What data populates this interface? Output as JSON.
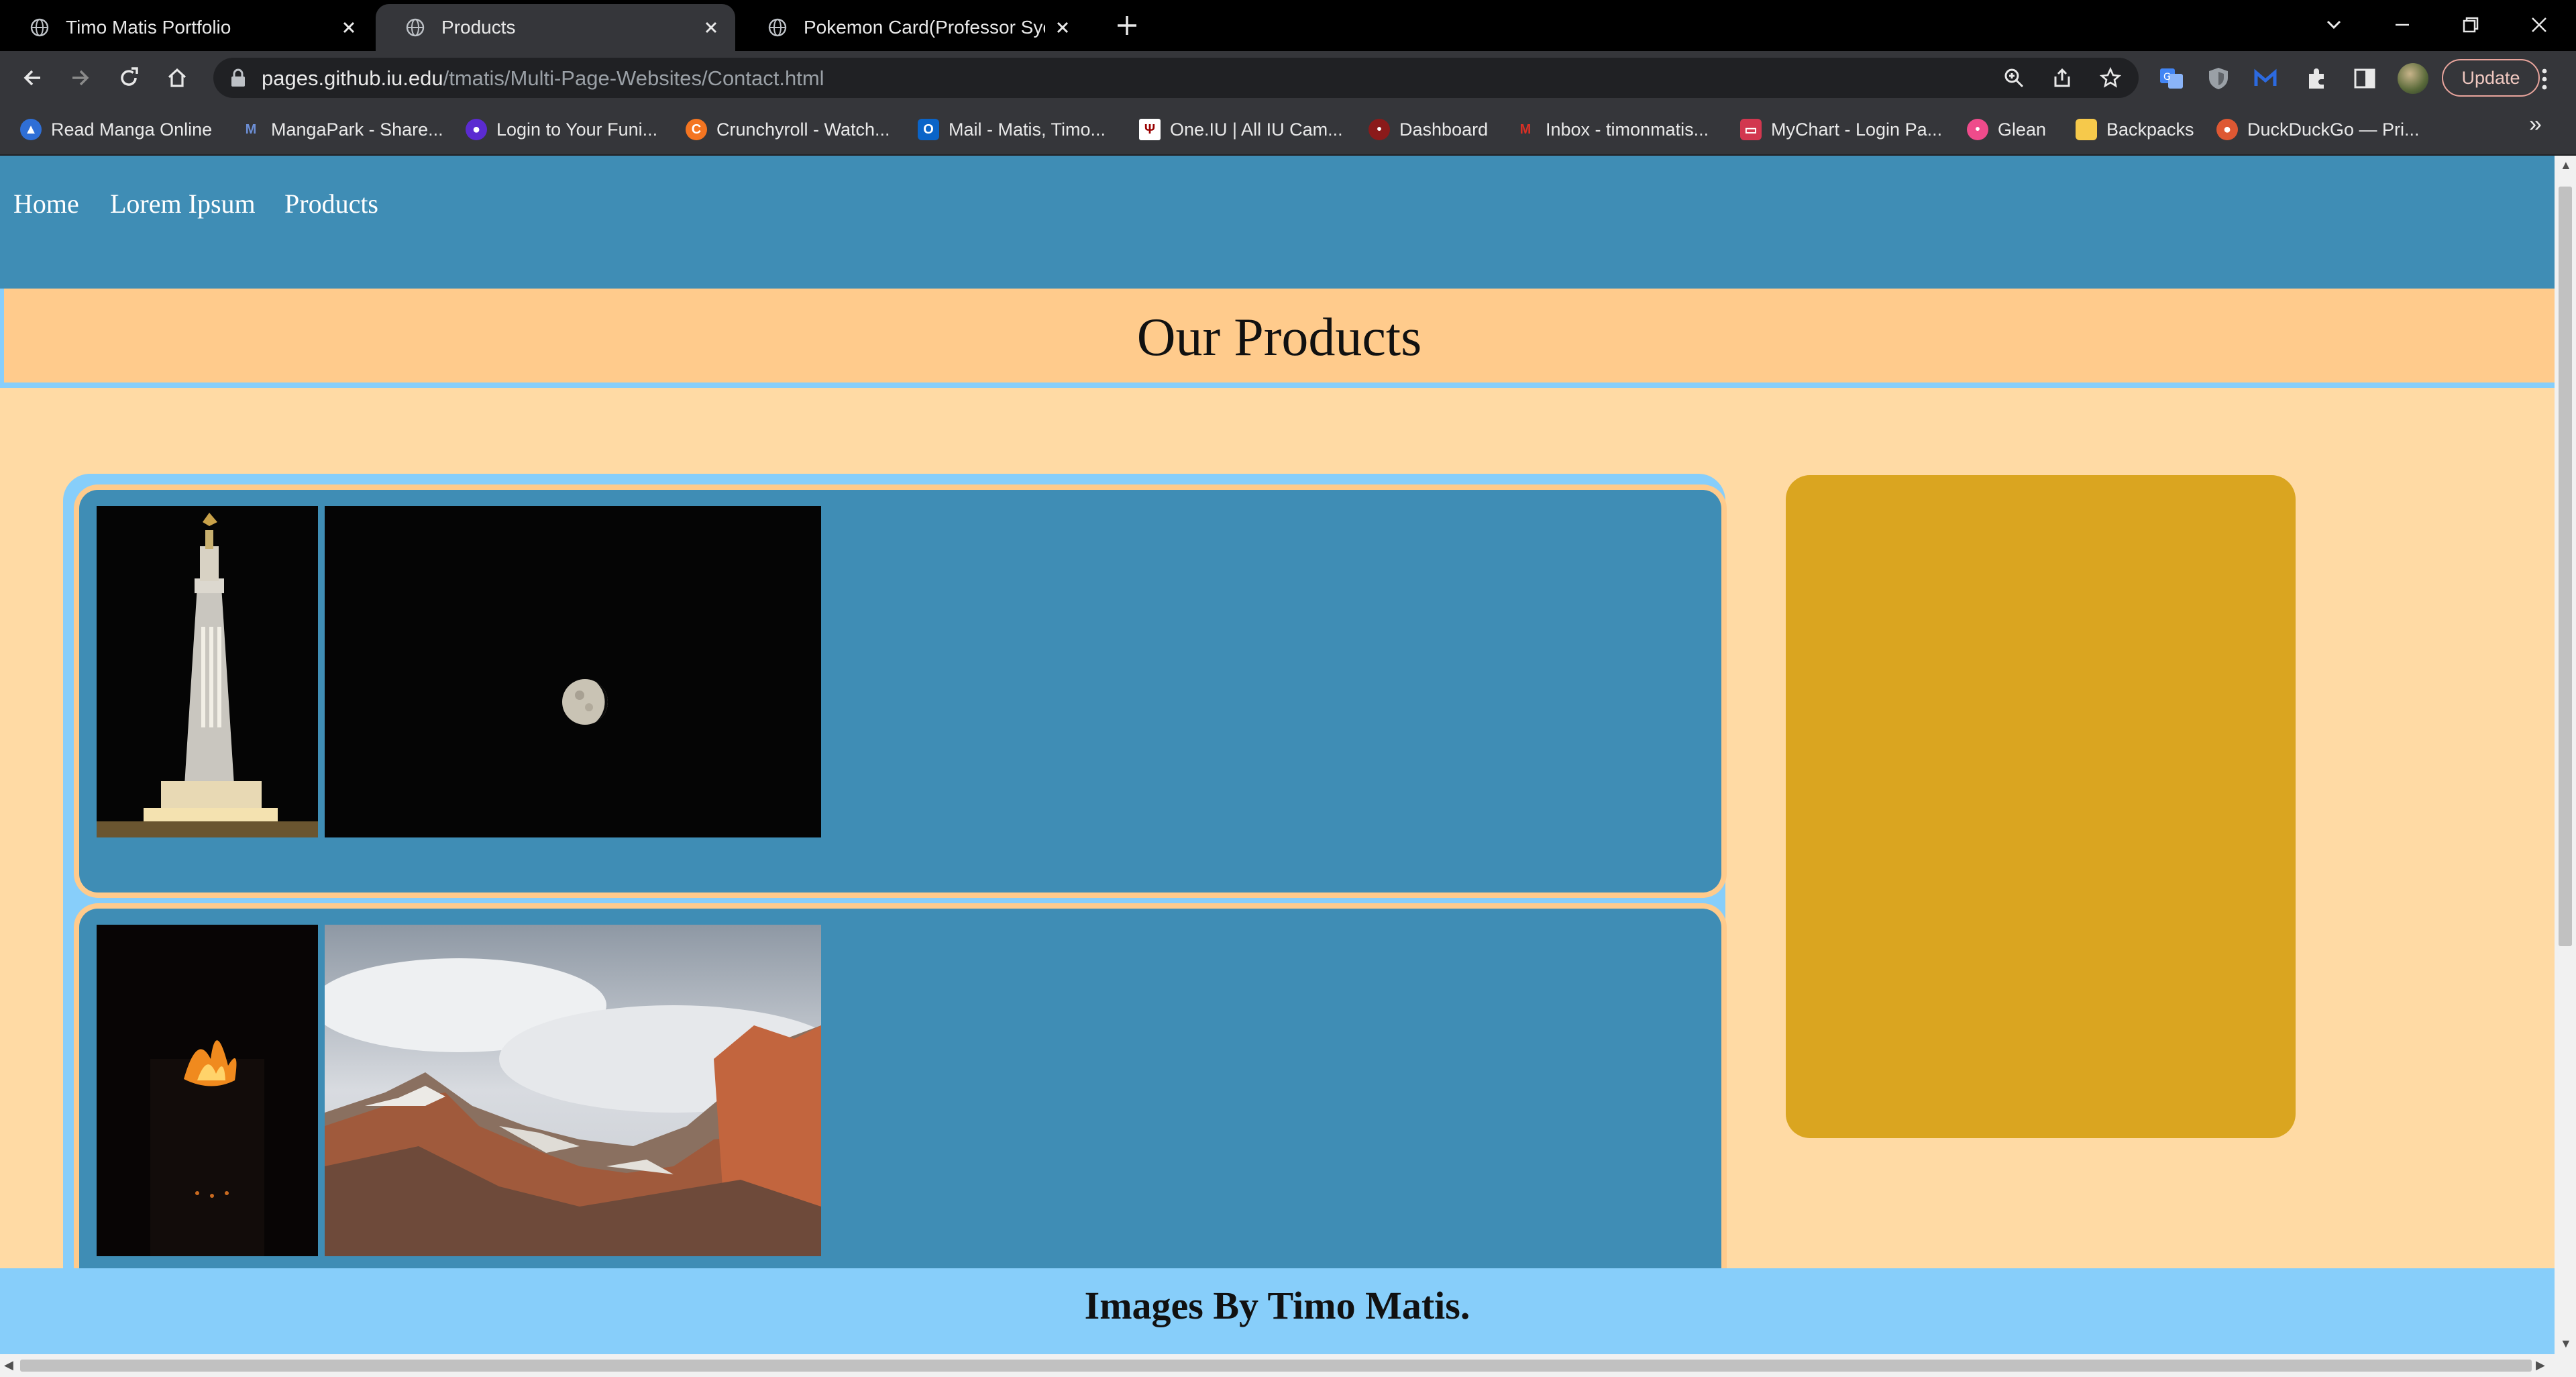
{
  "browser": {
    "tabs": [
      {
        "title": "Timo Matis Portfolio",
        "active": false
      },
      {
        "title": "Products",
        "active": true
      },
      {
        "title": "Pokemon Card(Professor Sycamore",
        "active": false
      }
    ],
    "url_host": "pages.github.iu.edu",
    "url_path": "/tmatis/Multi-Page-Websites/Contact.html",
    "update_label": "Update",
    "bookmarks": [
      {
        "label": "Read Manga Online",
        "icon": "manga-icon",
        "color": "#2f6fd6"
      },
      {
        "label": "MangaPark - Share...",
        "icon": "mangapark-icon",
        "color": "#3b6bb5"
      },
      {
        "label": "Login to Your Funi...",
        "icon": "funimation-icon",
        "color": "#5b2bd1"
      },
      {
        "label": "Crunchyroll - Watch...",
        "icon": "crunchyroll-icon",
        "color": "#f47521"
      },
      {
        "label": "Mail - Matis, Timo...",
        "icon": "outlook-icon",
        "color": "#0a64c8"
      },
      {
        "label": "One.IU | All IU Cam...",
        "icon": "iu-icon",
        "color": "#990000"
      },
      {
        "label": "Dashboard",
        "icon": "dashboard-icon",
        "color": "#8b1a1a"
      },
      {
        "label": "Inbox - timonmatis...",
        "icon": "gmail-icon",
        "color": "#d93025"
      },
      {
        "label": "MyChart - Login Pa...",
        "icon": "mychart-icon",
        "color": "#d2374f"
      },
      {
        "label": "Glean",
        "icon": "glean-icon",
        "color": "#ef4b8b"
      },
      {
        "label": "Backpacks",
        "icon": "folder-icon",
        "color": "#f6c94b"
      },
      {
        "label": "DuckDuckGo — Pri...",
        "icon": "duckduckgo-icon",
        "color": "#de5833"
      }
    ]
  },
  "site": {
    "nav": [
      "Home",
      "Lorem Ipsum",
      "Products"
    ],
    "heading": "Our Products",
    "footer": "Images By Timo Matis.",
    "colors": {
      "nav_bg": "#3f8db5",
      "page_bg": "#ffdaa4",
      "heading_band": "#ffcb8c",
      "accent_blue": "#87cefa",
      "sidebar": "#daa520"
    },
    "products": [
      {
        "images": [
          "temple-spire-photo",
          "moon-photo"
        ]
      },
      {
        "images": [
          "campfire-photo",
          "zion-canyon-photo"
        ]
      }
    ]
  }
}
